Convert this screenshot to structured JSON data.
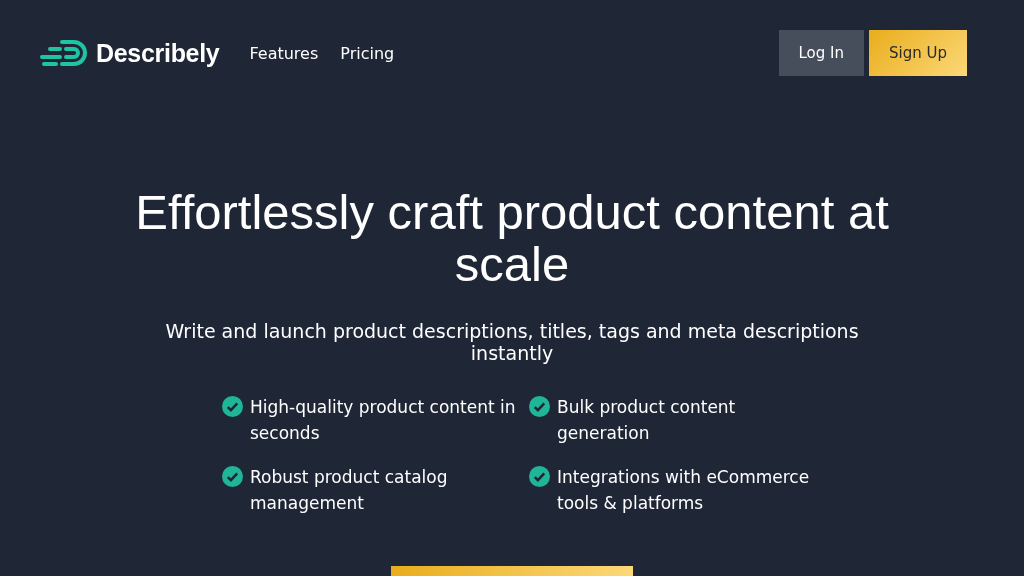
{
  "nav": {
    "brand": "Describely",
    "links": [
      {
        "label": "Features"
      },
      {
        "label": "Pricing"
      }
    ],
    "buttons": [
      {
        "label": "Log In",
        "kind": "secondary"
      },
      {
        "label": "Sign Up",
        "kind": "primary"
      }
    ]
  },
  "hero": {
    "title": "Effortlessly craft product content at scale",
    "subtitle": "Write and launch product descriptions, titles, tags and meta descriptions instantly",
    "features": [
      {
        "text": "High-quality product content in seconds"
      },
      {
        "text": "Bulk product content generation"
      },
      {
        "text": "Robust product catalog management"
      },
      {
        "text": "Integrations with eCommerce tools & platforms"
      }
    ]
  }
}
